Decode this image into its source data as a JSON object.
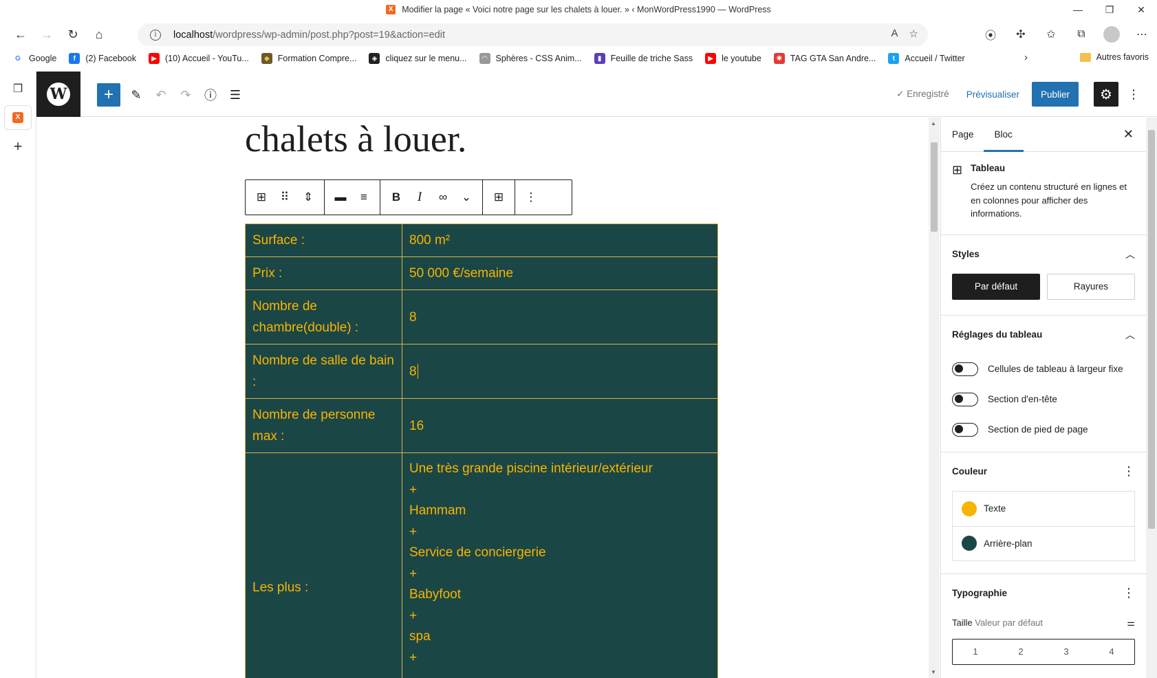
{
  "browser": {
    "window_title": "Modifier la page « Voici notre page sur les chalets à louer. » ‹ MonWordPress1990 — WordPress",
    "url_host": "localhost",
    "url_path": "/wordpress/wp-admin/post.php?post=19&action=edit",
    "bookmarks": [
      {
        "label": "Google",
        "color": "#ffffff",
        "glyph": "G",
        "glyph_color": "#4285f4"
      },
      {
        "label": "(2) Facebook",
        "color": "#1877f2",
        "glyph": "f",
        "glyph_color": "#ffffff"
      },
      {
        "label": "(10) Accueil - YouTu...",
        "color": "#ff0000",
        "glyph": "▶",
        "glyph_color": "#ffffff"
      },
      {
        "label": "Formation Compre...",
        "color": "#6b5b2a",
        "glyph": "◆",
        "glyph_color": "#f2c14e"
      },
      {
        "label": "cliquez sur le menu...",
        "color": "#222222",
        "glyph": "◈",
        "glyph_color": "#ffffff"
      },
      {
        "label": "Sphères - CSS Anim...",
        "color": "#999999",
        "glyph": "◠",
        "glyph_color": "#ffffff"
      },
      {
        "label": "Feuille de triche Sass",
        "color": "#5b3fb8",
        "glyph": "▮",
        "glyph_color": "#ffffff"
      },
      {
        "label": "le youtube",
        "color": "#ff0000",
        "glyph": "▶",
        "glyph_color": "#ffffff"
      },
      {
        "label": "TAG GTA San Andre...",
        "color": "#e53935",
        "glyph": "✱",
        "glyph_color": "#ffffff"
      },
      {
        "label": "Accueil / Twitter",
        "color": "#1da1f2",
        "glyph": "t",
        "glyph_color": "#ffffff"
      }
    ],
    "other_favorites": "Autres favoris"
  },
  "wp_header": {
    "saved_label": "Enregistré",
    "preview_label": "Prévisualiser",
    "publish_label": "Publier"
  },
  "editor": {
    "title_partial": "chalets à louer.",
    "table_rows": [
      {
        "key": "Surface :",
        "value": "800 m²"
      },
      {
        "key": "Prix :",
        "value": "50 000 €/semaine"
      },
      {
        "key": "Nombre de chambre(double) :",
        "value": "8"
      },
      {
        "key": "Nombre de salle de bain :",
        "value": "8"
      },
      {
        "key": "Nombre de personne max :",
        "value": "16"
      }
    ],
    "plus_key": "Les plus :",
    "plus_items": [
      "Une très grande piscine intérieur/extérieur",
      "+",
      "Hammam",
      "+",
      "Service de conciergerie",
      "+",
      "Babyfoot",
      "+",
      "spa",
      "+"
    ]
  },
  "sidebar": {
    "tab_page": "Page",
    "tab_bloc": "Bloc",
    "block_name": "Tableau",
    "block_description": "Créez un contenu structuré en lignes et en colonnes pour afficher des informations.",
    "styles_title": "Styles",
    "style_default": "Par défaut",
    "style_stripes": "Rayures",
    "table_settings_title": "Réglages du tableau",
    "toggle_fixed": "Cellules de tableau à largeur fixe",
    "toggle_header": "Section d'en-tête",
    "toggle_footer": "Section de pied de page",
    "color_title": "Couleur",
    "color_text": "Texte",
    "color_text_value": "#f7b500",
    "color_bg": "Arrière-plan",
    "color_bg_value": "#1b4646",
    "typo_title": "Typographie",
    "size_label": "Taille",
    "size_value": "Valeur par défaut",
    "size_options": [
      "1",
      "2",
      "3",
      "4"
    ]
  }
}
